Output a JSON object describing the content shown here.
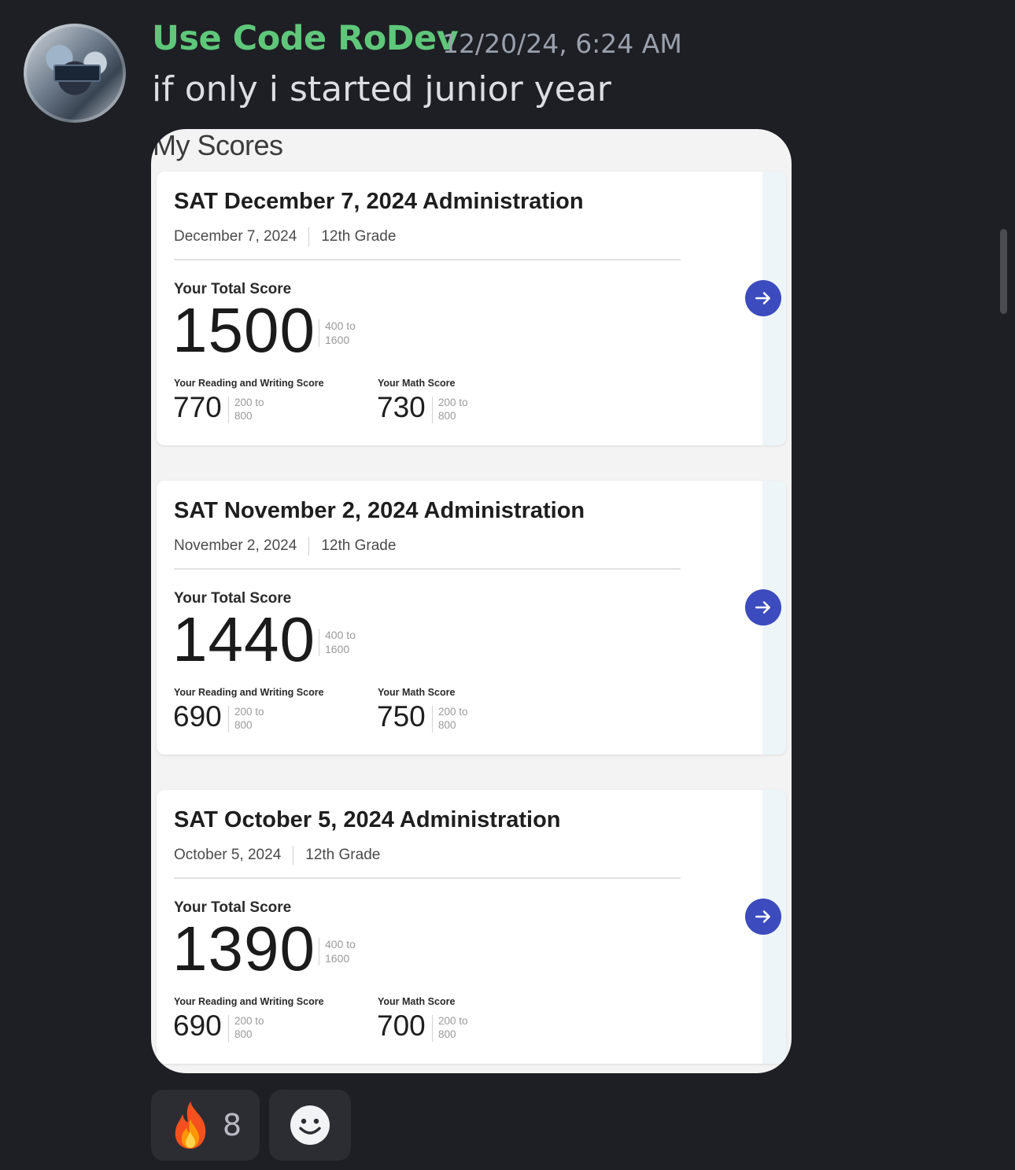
{
  "message": {
    "username": "Use Code RoDev",
    "timestamp": "12/20/24, 6:24 AM",
    "text": "if only i started junior year",
    "username_color": "#5fc77a"
  },
  "attachment": {
    "heading": "My Scores",
    "total_label": "Your Total Score",
    "total_range_top": "400 to",
    "total_range_bottom": "1600",
    "rw_label": "Your Reading and Writing Score",
    "math_label": "Your Math Score",
    "section_range_top": "200 to",
    "section_range_bottom": "800",
    "accent_color": "#3c4bbd",
    "cards": [
      {
        "title": "SAT December 7, 2024 Administration",
        "date": "December 7, 2024",
        "grade": "12th Grade",
        "total": "1500",
        "reading_writing": "770",
        "math": "730"
      },
      {
        "title": "SAT November 2, 2024 Administration",
        "date": "November 2, 2024",
        "grade": "12th Grade",
        "total": "1440",
        "reading_writing": "690",
        "math": "750"
      },
      {
        "title": "SAT October 5, 2024 Administration",
        "date": "October 5, 2024",
        "grade": "12th Grade",
        "total": "1390",
        "reading_writing": "690",
        "math": "700"
      }
    ]
  },
  "reactions": [
    {
      "icon": "fire-emoji-icon",
      "count": "8"
    },
    {
      "icon": "add-reaction-smiley-icon"
    }
  ]
}
